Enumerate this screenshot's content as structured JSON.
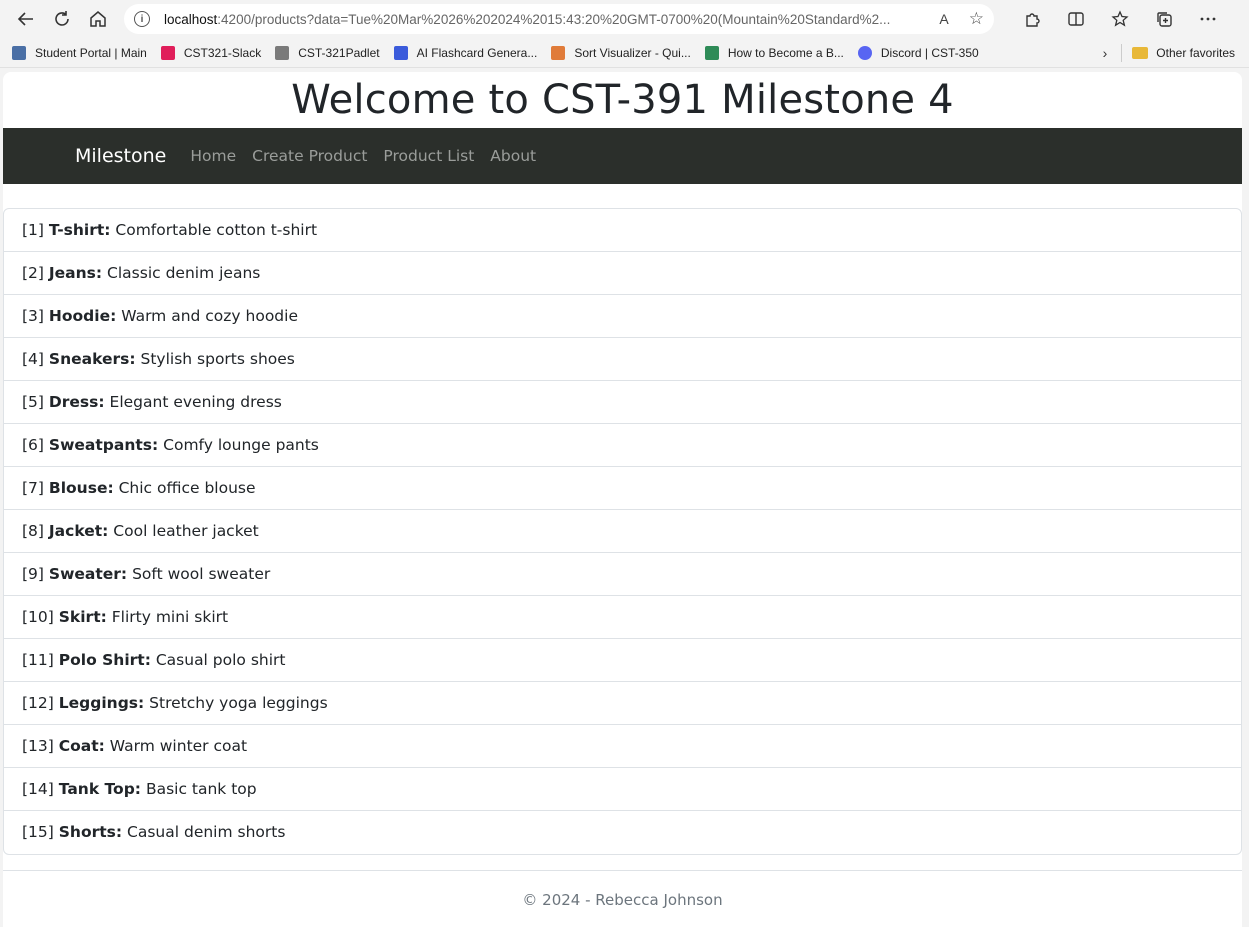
{
  "browser": {
    "url_host": "localhost",
    "url_rest": ":4200/products?data=Tue%20Mar%2026%202024%2015:43:20%20GMT-0700%20(Mountain%20Standard%2...",
    "bookmarks": [
      {
        "label": "Student Portal | Main",
        "color": "#4a6fa5"
      },
      {
        "label": "CST321-Slack",
        "color": "#e01e5a"
      },
      {
        "label": "CST-321Padlet",
        "color": "#7a7a7a"
      },
      {
        "label": "AI Flashcard Genera...",
        "color": "#3b5bdb"
      },
      {
        "label": "Sort Visualizer - Qui...",
        "color": "#e07b39"
      },
      {
        "label": "How to Become a B...",
        "color": "#2e8b57"
      },
      {
        "label": "Discord | CST-350",
        "color": "#5865f2"
      }
    ],
    "other_favorites": "Other favorites"
  },
  "page": {
    "heading": "Welcome to CST-391 Milestone 4",
    "nav": {
      "brand": "Milestone",
      "links": [
        "Home",
        "Create Product",
        "Product List",
        "About"
      ]
    },
    "products": [
      {
        "id": "[1]",
        "name": "T-shirt:",
        "desc": "Comfortable cotton t-shirt"
      },
      {
        "id": "[2]",
        "name": "Jeans:",
        "desc": "Classic denim jeans"
      },
      {
        "id": "[3]",
        "name": "Hoodie:",
        "desc": "Warm and cozy hoodie"
      },
      {
        "id": "[4]",
        "name": "Sneakers:",
        "desc": "Stylish sports shoes"
      },
      {
        "id": "[5]",
        "name": "Dress:",
        "desc": "Elegant evening dress"
      },
      {
        "id": "[6]",
        "name": "Sweatpants:",
        "desc": "Comfy lounge pants"
      },
      {
        "id": "[7]",
        "name": "Blouse:",
        "desc": "Chic office blouse"
      },
      {
        "id": "[8]",
        "name": "Jacket:",
        "desc": "Cool leather jacket"
      },
      {
        "id": "[9]",
        "name": "Sweater:",
        "desc": "Soft wool sweater"
      },
      {
        "id": "[10]",
        "name": "Skirt:",
        "desc": "Flirty mini skirt"
      },
      {
        "id": "[11]",
        "name": "Polo Shirt:",
        "desc": "Casual polo shirt"
      },
      {
        "id": "[12]",
        "name": "Leggings:",
        "desc": "Stretchy yoga leggings"
      },
      {
        "id": "[13]",
        "name": "Coat:",
        "desc": "Warm winter coat"
      },
      {
        "id": "[14]",
        "name": "Tank Top:",
        "desc": "Basic tank top"
      },
      {
        "id": "[15]",
        "name": "Shorts:",
        "desc": "Casual denim shorts"
      }
    ],
    "footer": "© 2024 - Rebecca Johnson"
  }
}
